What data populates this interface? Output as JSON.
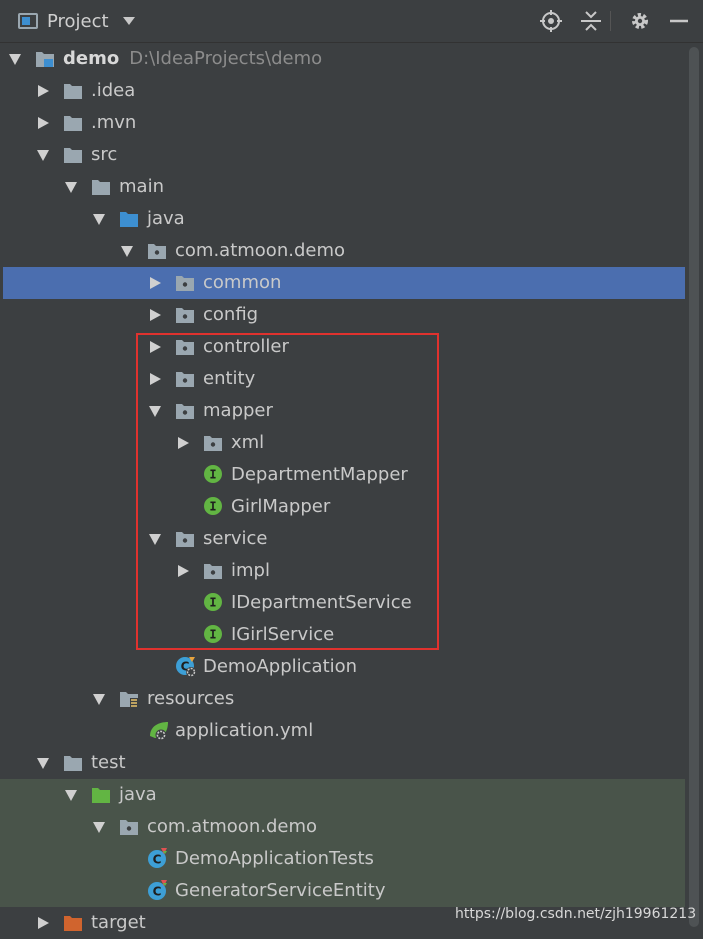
{
  "header": {
    "title": "Project",
    "tools": [
      {
        "name": "locate-icon"
      },
      {
        "name": "collapse-all-icon"
      },
      {
        "name": "gear-icon"
      },
      {
        "name": "hide-icon"
      }
    ]
  },
  "colors": {
    "background": "#3c3f41",
    "selection": "#4b6eaf",
    "test_bg": "#49544a",
    "folder": "#9aa7b0",
    "source_folder": "#3d8fd1",
    "test_folder": "#62b543",
    "excluded_folder": "#d0642e",
    "interface": "#62b543",
    "class": "#3d9fd6",
    "highlight_box": "#e0322e"
  },
  "tree": [
    {
      "label": "demo",
      "path": "D:\\IdeaProjects\\demo",
      "arrow": "down",
      "icon": "module",
      "bold": true
    },
    {
      "label": ".idea",
      "arrow": "right",
      "icon": "folder"
    },
    {
      "label": ".mvn",
      "arrow": "right",
      "icon": "folder"
    },
    {
      "label": "src",
      "arrow": "down",
      "icon": "folder"
    },
    {
      "label": "main",
      "arrow": "down",
      "icon": "folder"
    },
    {
      "label": "java",
      "arrow": "down",
      "icon": "source-folder"
    },
    {
      "label": "com.atmoon.demo",
      "arrow": "down",
      "icon": "package"
    },
    {
      "label": "common",
      "arrow": "right",
      "icon": "package",
      "selected": true
    },
    {
      "label": "config",
      "arrow": "right",
      "icon": "package"
    },
    {
      "label": "controller",
      "arrow": "right",
      "icon": "package"
    },
    {
      "label": "entity",
      "arrow": "right",
      "icon": "package"
    },
    {
      "label": "mapper",
      "arrow": "down",
      "icon": "package"
    },
    {
      "label": "xml",
      "arrow": "right",
      "icon": "package"
    },
    {
      "label": "DepartmentMapper",
      "arrow": "none",
      "icon": "interface"
    },
    {
      "label": "GirlMapper",
      "arrow": "none",
      "icon": "interface"
    },
    {
      "label": "service",
      "arrow": "down",
      "icon": "package"
    },
    {
      "label": "impl",
      "arrow": "right",
      "icon": "package"
    },
    {
      "label": "IDepartmentService",
      "arrow": "none",
      "icon": "interface"
    },
    {
      "label": "IGirlService",
      "arrow": "none",
      "icon": "interface"
    },
    {
      "label": "DemoApplication",
      "arrow": "none",
      "icon": "spring-class"
    },
    {
      "label": "resources",
      "arrow": "down",
      "icon": "resources-folder"
    },
    {
      "label": "application.yml",
      "arrow": "none",
      "icon": "yml-file"
    },
    {
      "label": "test",
      "arrow": "down",
      "icon": "folder"
    },
    {
      "label": "java",
      "arrow": "down",
      "icon": "test-folder",
      "test": true
    },
    {
      "label": "com.atmoon.demo",
      "arrow": "down",
      "icon": "package",
      "test": true
    },
    {
      "label": "DemoApplicationTests",
      "arrow": "none",
      "icon": "test-class",
      "test": true
    },
    {
      "label": "GeneratorServiceEntity",
      "arrow": "none",
      "icon": "test-class",
      "test": true
    },
    {
      "label": "target",
      "arrow": "right",
      "icon": "excluded-folder"
    }
  ],
  "watermark": "https://blog.csdn.net/zjh19961213"
}
